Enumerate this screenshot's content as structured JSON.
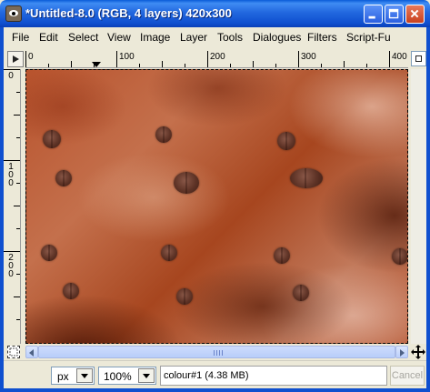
{
  "window": {
    "title": "*Untitled-8.0 (RGB, 4 layers) 420x300"
  },
  "menu": [
    {
      "label": "File"
    },
    {
      "label": "Edit"
    },
    {
      "label": "Select"
    },
    {
      "label": "View"
    },
    {
      "label": "Image"
    },
    {
      "label": "Layer"
    },
    {
      "label": "Tools"
    },
    {
      "label": "Dialogues"
    },
    {
      "label": "Filters"
    },
    {
      "label": "Script-Fu"
    }
  ],
  "rulers": {
    "horizontal_labels": [
      "0",
      "100",
      "200",
      "300",
      "400"
    ],
    "vertical_labels": [
      "0",
      "100",
      "200"
    ]
  },
  "statusbar": {
    "unit": "px",
    "zoom": "100%",
    "message": "colour#1 (4.38 MB)",
    "cancel_label": "Cancel"
  },
  "icons": {
    "title_controls": [
      "minimize-icon",
      "maximize-icon",
      "close-icon"
    ],
    "ruler_menu": "triangle-right-icon",
    "navigate": "navigate-icon",
    "quick_mask": "quick-mask-icon",
    "move": "move-arrows-icon"
  },
  "colors": {
    "titlebar": "#2268df",
    "canvas_base": "#b8532d"
  }
}
